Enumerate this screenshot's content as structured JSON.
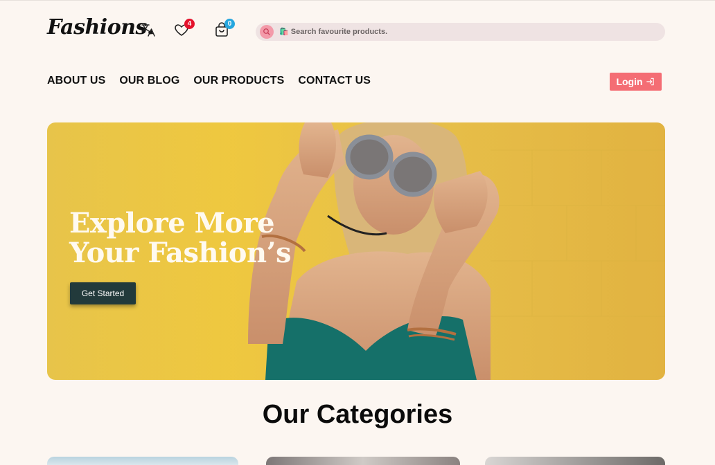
{
  "header": {
    "logo": "Fashions.",
    "wishlist_count": "4",
    "cart_count": "0",
    "search_placeholder": "🛍️ Search favourite products."
  },
  "nav": {
    "items": [
      "ABOUT US",
      "OUR BLOG",
      "OUR PRODUCTS",
      "CONTACT US"
    ],
    "login_label": "Login"
  },
  "hero": {
    "title_line1": "Explore More",
    "title_line2": "Your Fashion’s",
    "cta_label": "Get Started"
  },
  "categories": {
    "title": "Our Categories"
  },
  "colors": {
    "accent": "#f46d74",
    "cta": "#223a3b",
    "background": "#fcf6f1",
    "hero": "#f0c93e"
  }
}
